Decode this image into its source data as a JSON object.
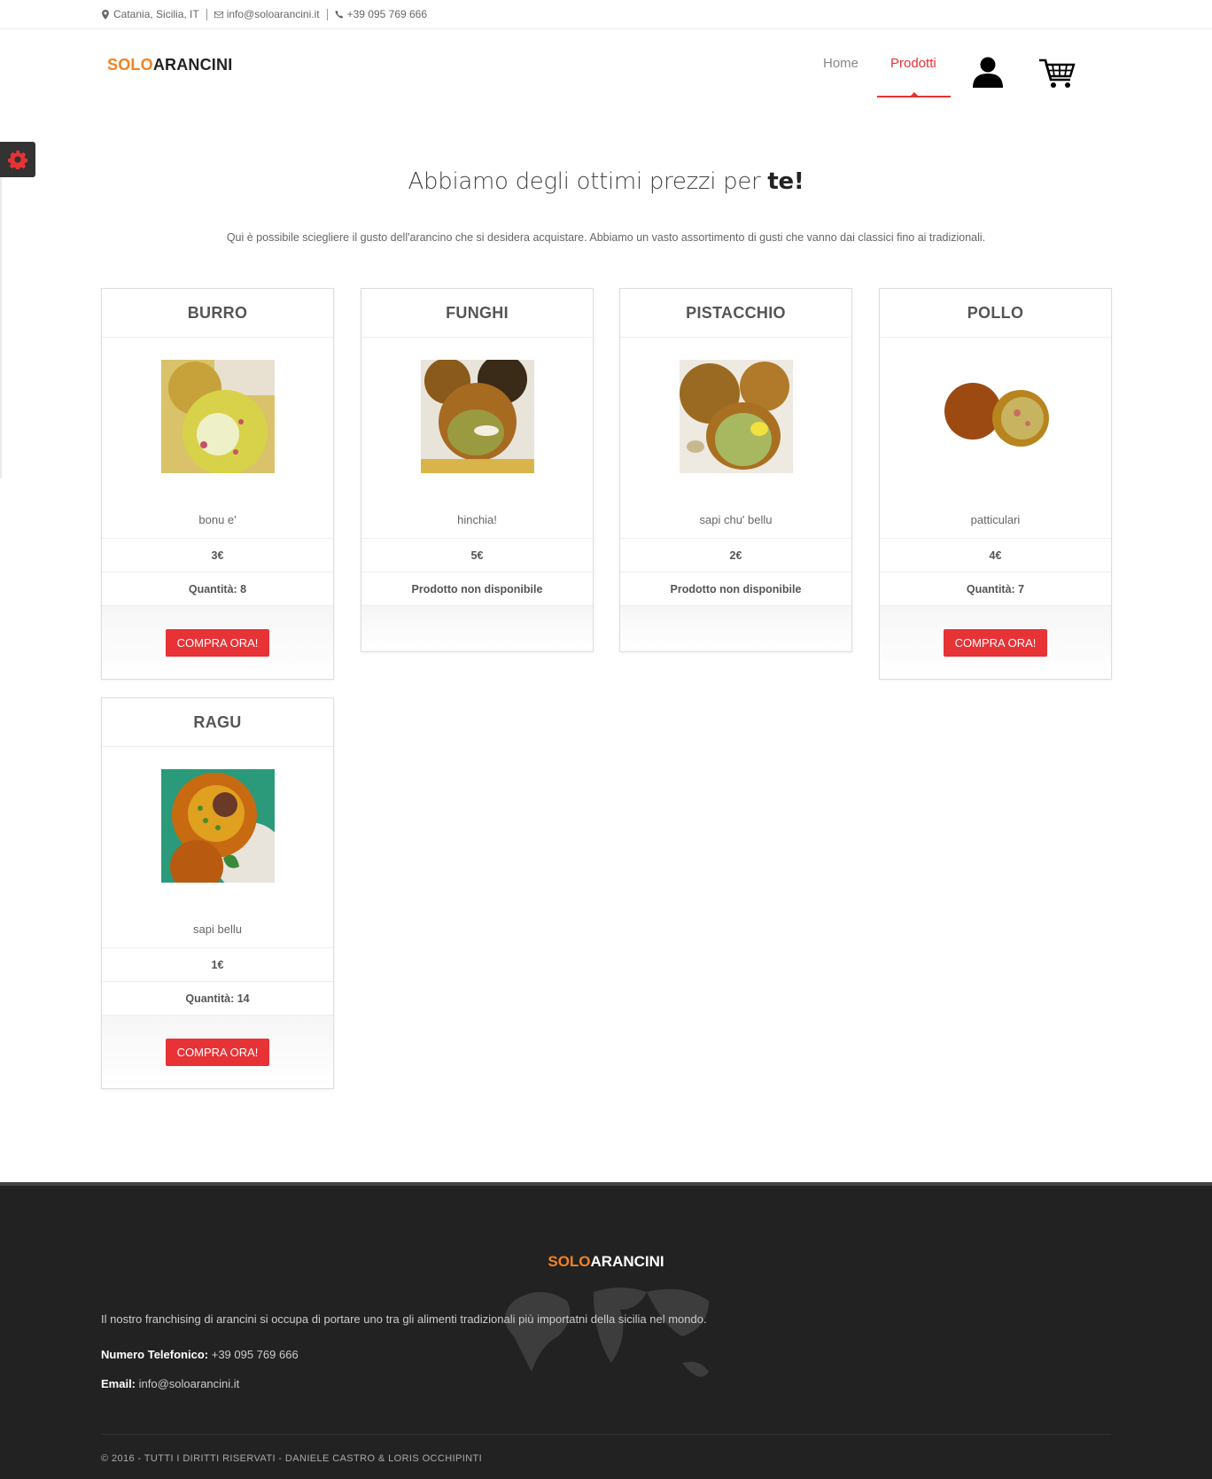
{
  "topbar": {
    "location": "Catania, Sicilia, IT",
    "email": "info@soloarancini.it",
    "phone": "+39 095 769 666"
  },
  "header": {
    "logo_a": "SOLO",
    "logo_b": "ARANCINI",
    "nav": {
      "home": "Home",
      "products": "Prodotti"
    }
  },
  "main": {
    "heading_pre": "Abbiamo degli ottimi prezzi per ",
    "heading_bold": "te!",
    "subtitle": "Qui è possibile sciegliere il gusto dell'arancino che si desidera acquistare. Abbiamo un vasto assortimento di gusti che vanno dai classici fino ai tradizionali."
  },
  "products": [
    {
      "name": "BURRO",
      "desc": "bonu e'",
      "price": "3€",
      "qty": "Quantità: 8",
      "button": "COMPRA ORA!"
    },
    {
      "name": "FUNGHI",
      "desc": "hinchia!",
      "price": "5€",
      "qty": "Prodotto non disponibile",
      "button": ""
    },
    {
      "name": "PISTACCHIO",
      "desc": "sapi chu' bellu",
      "price": "2€",
      "qty": "Prodotto non disponibile",
      "button": ""
    },
    {
      "name": "POLLO",
      "desc": "patticulari",
      "price": "4€",
      "qty": "Quantità: 7",
      "button": "COMPRA ORA!"
    },
    {
      "name": "RAGU",
      "desc": "sapi bellu",
      "price": "1€",
      "qty": "Quantità: 14",
      "button": "COMPRA ORA!"
    }
  ],
  "footer": {
    "logo_a": "SOLO",
    "logo_b": "ARANCINI",
    "description": "Il nostro franchising di arancini si occupa di portare uno tra gli alimenti tradizionali più importatni della sicilia nel mondo.",
    "phone_label": "Numero Telefonico:",
    "phone": " +39 095 769 666",
    "email_label": "Email:",
    "email": " info@soloarancini.it",
    "copyright": "© 2016 - TUTTI I DIRITTI RISERVATI - DANIELE CASTRO & LORIS OCCHIPINTI"
  },
  "colors": {
    "accent": "#e73236",
    "brand_orange": "#f58220",
    "footer_bg": "#222222"
  },
  "icons": [
    "map-marker-icon",
    "envelope-icon",
    "phone-icon",
    "user-icon",
    "cart-icon",
    "gear-icon"
  ]
}
